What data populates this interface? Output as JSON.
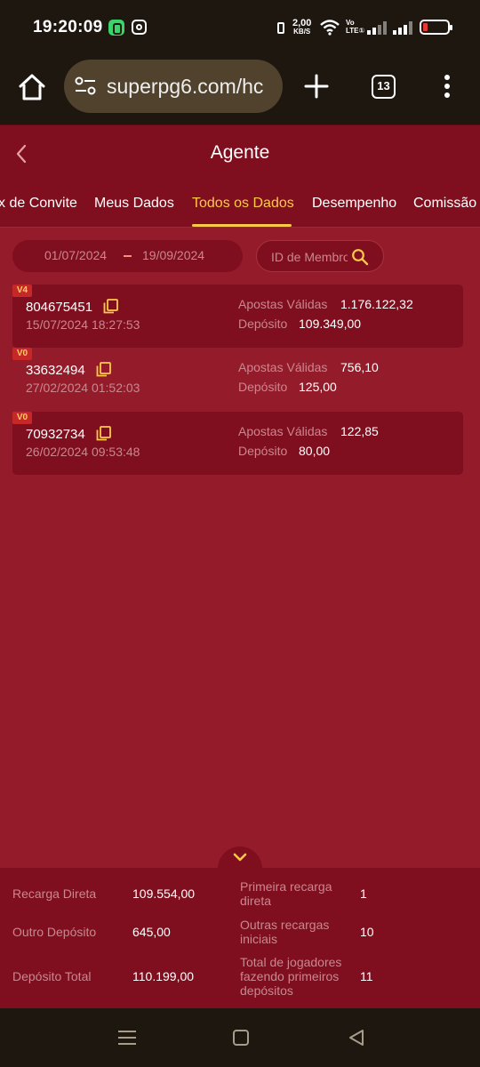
{
  "status_bar": {
    "time": "19:20:09",
    "net_speed": "2,00",
    "net_unit": "KB/S",
    "volte_top": "Vo",
    "volte_bottom": "LTE①",
    "icons": [
      "whatsapp-icon",
      "instagram-icon",
      "vibrate-icon",
      "wifi-icon",
      "signal-icon",
      "battery-icon"
    ],
    "battery_color": "#e53935"
  },
  "browser": {
    "url": "superpg6.com/hc",
    "tab_count": "13"
  },
  "header": {
    "title": "Agente"
  },
  "tabs": [
    {
      "label": "x de Convite"
    },
    {
      "label": "Meus Dados"
    },
    {
      "label": "Todos os Dados",
      "active": true
    },
    {
      "label": "Desempenho"
    },
    {
      "label": "Comissão"
    }
  ],
  "filters": {
    "date_from": "01/07/2024",
    "date_to": "19/09/2024",
    "search_placeholder": "ID de Membro"
  },
  "records": [
    {
      "level": "V4",
      "id": "804675451",
      "datetime": "15/07/2024 18:27:53",
      "apostas_label": "Apostas Válidas",
      "apostas": "1.176.122,32",
      "deposito_label": "Depósito",
      "deposito": "109.349,00"
    },
    {
      "level": "V0",
      "id": "33632494",
      "datetime": "27/02/2024 01:52:03",
      "apostas_label": "Apostas Válidas",
      "apostas": "756,10",
      "deposito_label": "Depósito",
      "deposito": "125,00"
    },
    {
      "level": "V0",
      "id": "70932734",
      "datetime": "26/02/2024 09:53:48",
      "apostas_label": "Apostas Válidas",
      "apostas": "122,85",
      "deposito_label": "Depósito",
      "deposito": "80,00"
    }
  ],
  "summary": {
    "recarga_direta_label": "Recarga Direta",
    "recarga_direta": "109.554,00",
    "outro_deposito_label": "Outro Depósito",
    "outro_deposito": "645,00",
    "deposito_total_label": "Depósito Total",
    "deposito_total": "110.199,00",
    "primeira_recarga_label": "Primeira recarga direta",
    "primeira_recarga": "1",
    "outras_recargas_label": "Outras recargas iniciais",
    "outras_recargas": "10",
    "total_jogadores_label": "Total de jogadores fazendo primeiros depósitos",
    "total_jogadores": "11"
  },
  "colors": {
    "background": "#941c2a",
    "panel": "#7f0f1e",
    "accent": "#ffc94a",
    "muted_text": "#c98790",
    "system_bar": "#1e1710"
  }
}
